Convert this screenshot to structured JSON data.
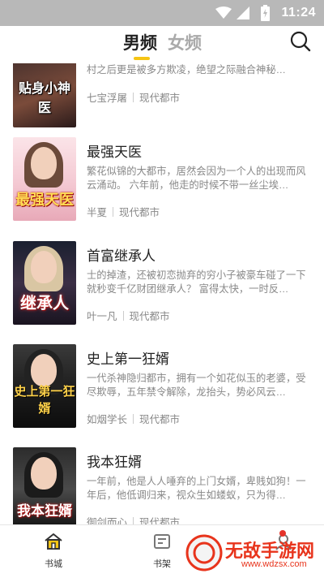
{
  "status_bar": {
    "time": "11:24"
  },
  "header": {
    "tabs": [
      {
        "label": "男频",
        "active": true
      },
      {
        "label": "女频",
        "active": false
      }
    ],
    "accent_color": "#f6c514"
  },
  "books": [
    {
      "title": "",
      "cover_text": "贴身小神医",
      "description": "山村走出的少年林村，因被陷害惨遭学校开除，回村之后更是被多方欺凌，绝望之际融合神秘…",
      "author": "七宝浮屠",
      "category": "现代都市"
    },
    {
      "title": "最强天医",
      "cover_text": "最强天医",
      "description": "繁花似锦的大都市，居然会因为一个人的出现而风云涌动。 六年前，他走的时候不带一丝尘埃…",
      "author": "半夏",
      "category": "现代都市"
    },
    {
      "title": "首富继承人",
      "cover_text": "继承人",
      "description": "士的掉渣，还被初恋抛弃的穷小子被豪车碰了一下就秒变千亿财团继承人？ 富得太快，一时反…",
      "author": "叶一凡",
      "category": "现代都市"
    },
    {
      "title": "史上第一狂婿",
      "cover_text": "史上第一狂婿",
      "description": "一代杀神隐归都市，拥有一个如花似玉的老婆，受尽欺辱，五年禁令解除，龙抬头，势必风云…",
      "author": "如烟学长",
      "category": "现代都市"
    },
    {
      "title": "我本狂婿",
      "cover_text": "我本狂婿",
      "description": "一年前，他是人人唾弃的上门女婿，卑贱如狗！一年后，他低调归来，视众生如蝼蚁，只为得…",
      "author": "御剑而心",
      "category": "现代都市"
    }
  ],
  "bottom_nav": [
    {
      "label": "书城",
      "icon": "home-icon",
      "active": true
    },
    {
      "label": "书架",
      "icon": "bookshelf-icon",
      "active": false
    },
    {
      "label": "",
      "icon": "profile-icon",
      "active": false
    }
  ],
  "watermark": {
    "text": "无敌手游网",
    "url": "www.wdzsx.com"
  }
}
